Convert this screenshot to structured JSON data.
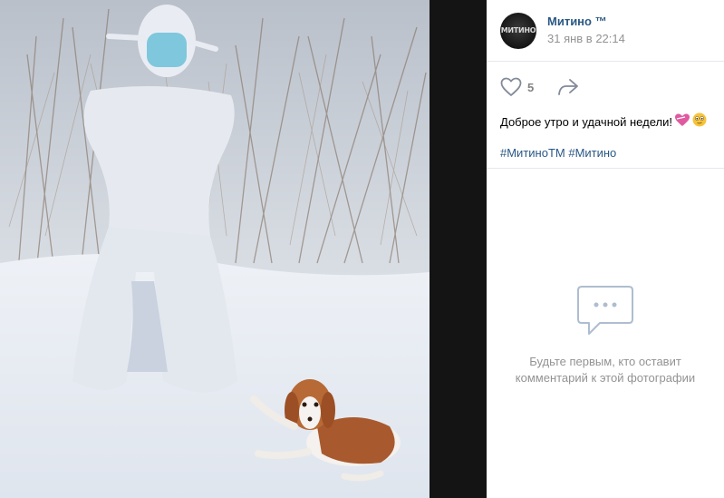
{
  "post": {
    "author": "Митино ™",
    "avatar_text": "МИТИНО",
    "date": "31 янв в 22:14",
    "likes": "5",
    "text": "Доброе утро и удачной недели!",
    "hashtags": [
      "#МитиноТМ",
      "#Митино"
    ]
  },
  "comments": {
    "empty_line1": "Будьте первым, кто оставит",
    "empty_line2": "комментарий к этой фотографии"
  },
  "colors": {
    "link": "#2a5885",
    "muted": "#939393",
    "heart_pink": "#e05aa0"
  },
  "icons": [
    "like-heart-icon",
    "share-arrow-icon",
    "kiss-heart-icon",
    "face-emoji-icon",
    "comment-bubble-icon"
  ]
}
